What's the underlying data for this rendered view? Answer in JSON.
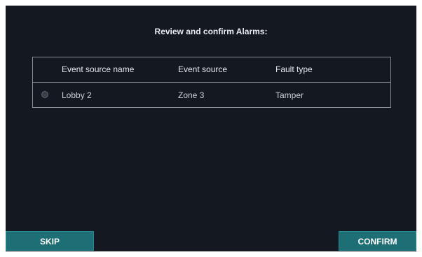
{
  "dialog": {
    "title": "Review and confirm Alarms:"
  },
  "table": {
    "columns": [
      "Event source name",
      "Event source",
      "Fault type"
    ],
    "rows": [
      {
        "name": "Lobby 2",
        "source": "Zone 3",
        "fault": "Tamper",
        "selected": false
      }
    ]
  },
  "buttons": {
    "skip": "SKIP",
    "confirm": "CONFIRM"
  },
  "colors": {
    "background": "#131821",
    "accent": "#1d6e75",
    "border": "#8a9098"
  }
}
